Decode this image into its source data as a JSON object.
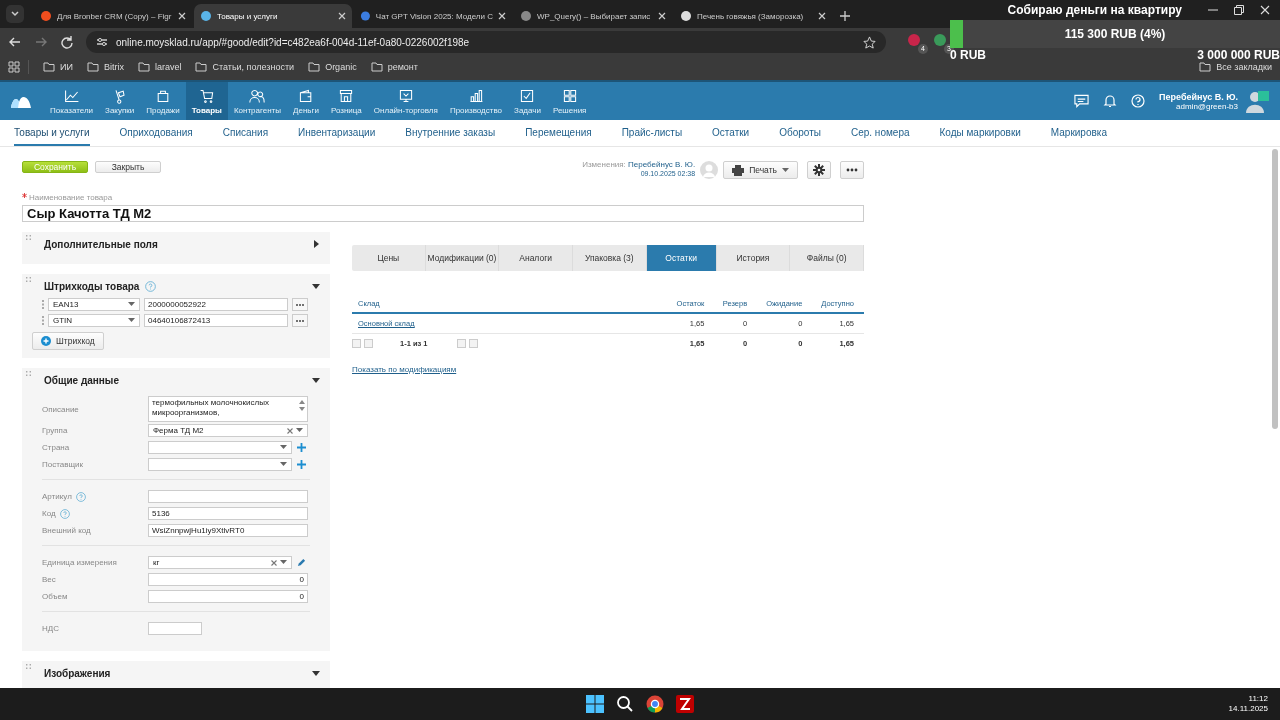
{
  "browser": {
    "tabs": [
      {
        "title": "Для Bronber CRM (Copy) – Figr",
        "selected": false
      },
      {
        "title": "Товары и услуги",
        "selected": true
      },
      {
        "title": "Чат GPT Vision 2025: Модели С",
        "selected": false
      },
      {
        "title": "WP_Query() – Выбирает запис",
        "selected": false
      },
      {
        "title": "Печень говяжья (Заморозка) ",
        "selected": false
      }
    ],
    "url": "online.moysklad.ru/app/#good/edit?id=c482ea6f-004d-11ef-0a80-0226002f198e",
    "extension_badges": [
      "4",
      "3"
    ],
    "bookmarks": [
      "ИИ",
      "Bitrix",
      "laravel",
      "Статьи, полезности",
      "Organic",
      "ремонт"
    ],
    "all_bookmarks": "Все закладки"
  },
  "goal": {
    "title": "Собираю деньги на квартиру",
    "raised": "115 300 RUB (4%)",
    "level": 0.04,
    "start": "0 RUB",
    "target": "3 000 000 RUB"
  },
  "header": {
    "nav": [
      {
        "label": "Показатели",
        "selected": false
      },
      {
        "label": "Закупки",
        "selected": false
      },
      {
        "label": "Продажи",
        "selected": false
      },
      {
        "label": "Товары",
        "selected": true
      },
      {
        "label": "Контрагенты",
        "selected": false
      },
      {
        "label": "Деньги",
        "selected": false
      },
      {
        "label": "Розница",
        "selected": false
      },
      {
        "label": "Онлайн-торговля",
        "selected": false
      },
      {
        "label": "Производство",
        "selected": false
      },
      {
        "label": "Задачи",
        "selected": false
      },
      {
        "label": "Решения",
        "selected": false
      }
    ],
    "user_name": "Перебейнус В. Ю.",
    "user_email": "admin@green-b3"
  },
  "subnav": [
    {
      "label": "Товары и услуги",
      "selected": true
    },
    {
      "label": "Оприходования",
      "selected": false
    },
    {
      "label": "Списания",
      "selected": false
    },
    {
      "label": "Инвентаризации",
      "selected": false
    },
    {
      "label": "Внутренние заказы",
      "selected": false
    },
    {
      "label": "Перемещения",
      "selected": false
    },
    {
      "label": "Прайс-листы",
      "selected": false
    },
    {
      "label": "Остатки",
      "selected": false
    },
    {
      "label": "Обороты",
      "selected": false
    },
    {
      "label": "Сер. номера",
      "selected": false
    },
    {
      "label": "Коды маркировки",
      "selected": false
    },
    {
      "label": "Маркировка",
      "selected": false
    }
  ],
  "toolbar": {
    "save": "Сохранить",
    "close": "Закрыть",
    "changes_label": "Изменения:",
    "changed_by": "Перебейнус В. Ю.",
    "changed_at": "09.10.2025 02:38",
    "print": "Печать"
  },
  "name_field": {
    "label": "Наименование товара",
    "required": true,
    "value": "Сыр Качотта ТД М2"
  },
  "extra_fields": {
    "title": "Дополнительные поля",
    "expanded": false
  },
  "barcodes": {
    "title": "Штрихкоды товара",
    "expanded": true,
    "rows": [
      {
        "type": "EAN13",
        "value": "2000000052922"
      },
      {
        "type": "GTIN",
        "value": "04640106872413"
      }
    ],
    "add_button": "Штрихкод"
  },
  "general": {
    "title": "Общие данные",
    "expanded": true,
    "groups": [
      [
        {
          "kind": "textarea",
          "label": "Описание",
          "value": "термофильных молочнокислых микроорганизмов,"
        },
        {
          "kind": "select",
          "label": "Группа",
          "value": "Ферма ТД М2",
          "clearable": true,
          "add": false
        },
        {
          "kind": "select",
          "label": "Страна",
          "clearable": false,
          "add": true
        },
        {
          "kind": "select",
          "label": "Поставщик",
          "clearable": false,
          "add": true
        }
      ],
      [
        {
          "kind": "text",
          "label": "Артикул",
          "help": true
        },
        {
          "kind": "text",
          "label": "Код",
          "value": "5136",
          "help": true
        },
        {
          "kind": "text",
          "label": "Внешний код",
          "value": "WsiZnnpwjHu1iy9XtlvRT0",
          "help": false
        }
      ],
      [
        {
          "kind": "unit",
          "label": "Единица измерения",
          "value": "кг"
        },
        {
          "kind": "number",
          "label": "Вес",
          "value": "0"
        },
        {
          "kind": "number",
          "label": "Объем",
          "value": "0"
        }
      ],
      [
        {
          "kind": "short",
          "label": "НДС"
        }
      ]
    ]
  },
  "images": {
    "title": "Изображения",
    "expanded": true
  },
  "tabs": [
    {
      "label": "Цены",
      "selected": false
    },
    {
      "label": "Модификации (0)",
      "selected": false
    },
    {
      "label": "Аналоги",
      "selected": false
    },
    {
      "label": "Упаковка (3)",
      "selected": false
    },
    {
      "label": "Остатки",
      "selected": true
    },
    {
      "label": "История",
      "selected": false
    },
    {
      "label": "Файлы (0)",
      "selected": false
    }
  ],
  "stock_table": {
    "columns": [
      "Склад",
      "Остаток",
      "Резерв",
      "Ожидание",
      "Доступно"
    ],
    "rows": [
      [
        "Основной склад",
        "1,65",
        "0",
        "0",
        "1,65"
      ]
    ],
    "pager": "1-1 из 1",
    "totals": [
      "1,65",
      "0",
      "0",
      "1,65"
    ]
  },
  "modifications_link": "Показать по модификациям",
  "taskbar": {
    "time": "11:12",
    "date": "14.11.2025"
  }
}
